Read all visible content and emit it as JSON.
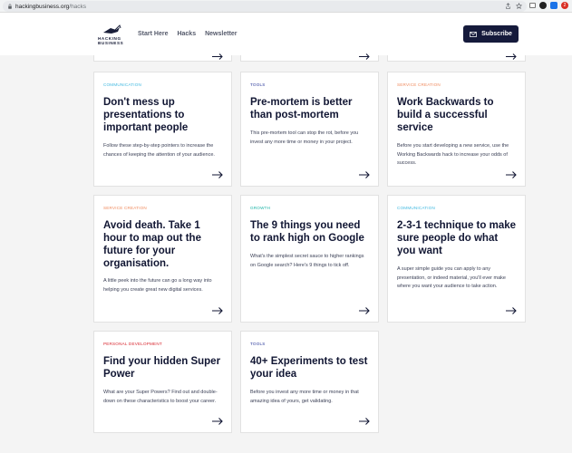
{
  "browser": {
    "url_host": "hackingbusiness.org",
    "url_path": "/hacks",
    "ext_badge": "2"
  },
  "header": {
    "logo_line1": "HACKING",
    "logo_line2": "BUSINESS",
    "nav": [
      "Start Here",
      "Hacks",
      "Newsletter"
    ],
    "subscribe_label": "Subscribe"
  },
  "colors": {
    "communication": "#3fb8e0",
    "tools": "#2b3a9b",
    "service_creation": "#f08a5d",
    "growth": "#1ab3a6",
    "personal_development": "#d8262e"
  },
  "cards": [
    {
      "category": "COMMUNICATION",
      "cat_color": "#3fb8e0",
      "title": "Don't mess up presentations to important people",
      "desc": "Follow these step-by-step pointers to increase the chances of keeping the attention of your audience."
    },
    {
      "category": "TOOLS",
      "cat_color": "#2b3a9b",
      "title": "Pre-mortem is better than post-mortem",
      "desc": "This pre-mortem tool can stop the rot, before you invest any more time or money in your project."
    },
    {
      "category": "SERVICE CREATION",
      "cat_color": "#f08a5d",
      "title": "Work Backwards to build a successful service",
      "desc": "Before you start developing a new service, use the Working Backwards hack to increase your odds of success."
    },
    {
      "category": "SERVICE CREATION",
      "cat_color": "#f08a5d",
      "title": "Avoid death. Take 1 hour to map out the future for your organisation.",
      "desc": "A little peek into the future can go a long way into helping you create great new digital services."
    },
    {
      "category": "GROWTH",
      "cat_color": "#1ab3a6",
      "title": "The 9 things you need to rank high on Google",
      "desc": "What's the simplest secret sauce to higher rankings on Google search? Here's 9 things to tick off."
    },
    {
      "category": "COMMUNICATION",
      "cat_color": "#3fb8e0",
      "title": "2-3-1 technique to make sure people do what you want",
      "desc": "A super simple guide you can apply to any presentation, or indeed material, you'll ever make where you want your audience to take action."
    },
    {
      "category": "PERSONAL DEVELOPMENT",
      "cat_color": "#d8262e",
      "title": "Find your hidden Super Power",
      "desc": "What are your Super Powers? Find out and double-down on these characteristics to boost your career."
    },
    {
      "category": "TOOLS",
      "cat_color": "#2b3a9b",
      "title": "40+ Experiments to test your idea",
      "desc": "Before you invest any more time or money in that amazing idea of yours, get validating."
    }
  ]
}
